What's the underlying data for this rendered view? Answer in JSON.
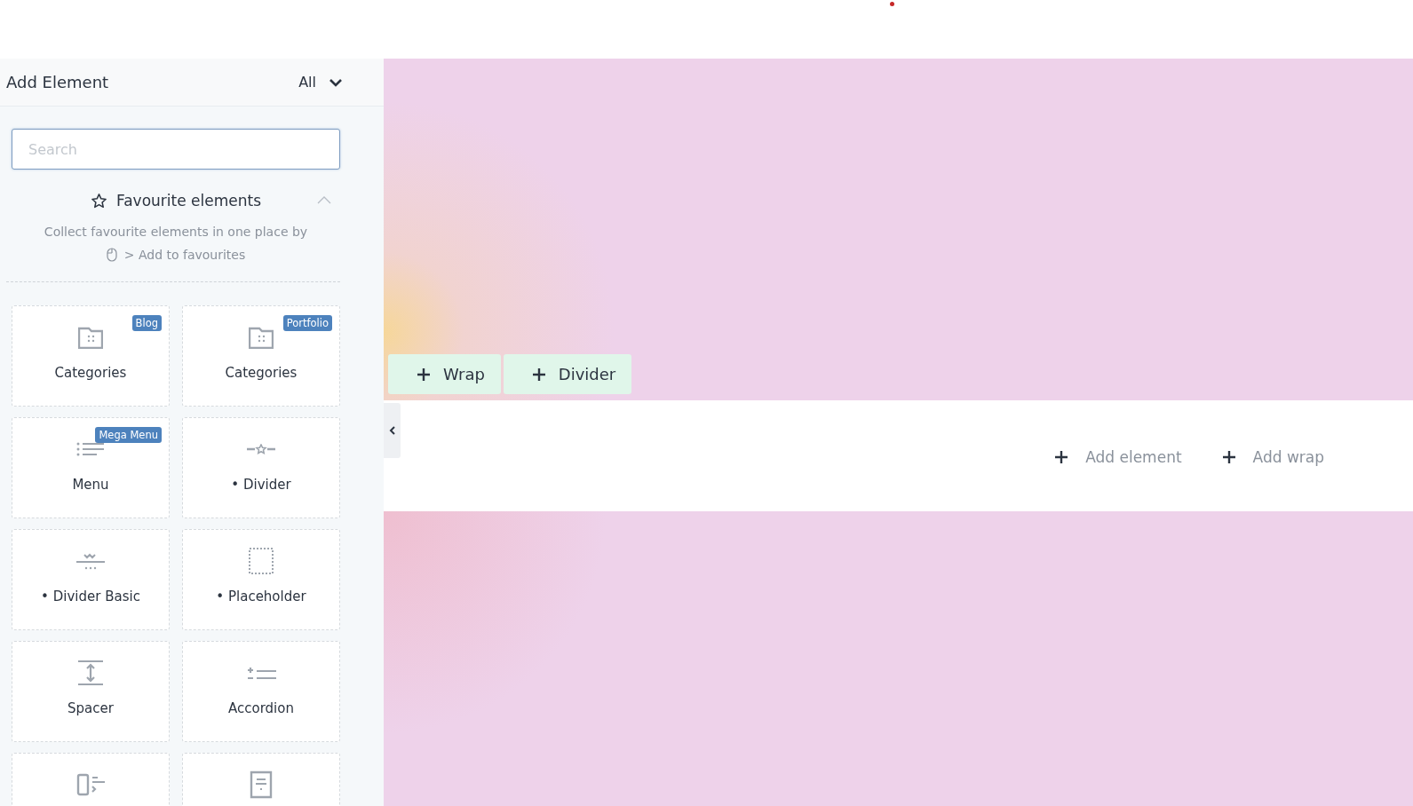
{
  "sidebar": {
    "title": "Add Element",
    "filter": "All",
    "search": {
      "placeholder": "Search"
    },
    "favourites": {
      "title": "Favourite elements",
      "expanded": true,
      "hint_line_1": "Collect favourite elements in one place by",
      "hint_line_2": "> Add to favourites"
    },
    "elements": [
      {
        "kind": "folder",
        "label": "Categories",
        "badge": "Blog"
      },
      {
        "kind": "folder",
        "label": "Categories",
        "badge": "Portfolio"
      },
      {
        "kind": "list",
        "label": "Menu",
        "badge": "Mega Menu"
      },
      {
        "kind": "stardivider",
        "label": "• Divider"
      },
      {
        "kind": "wavedivider",
        "label": "• Divider Basic"
      },
      {
        "kind": "placeholder",
        "label": "• Placeholder"
      },
      {
        "kind": "spacer",
        "label": "Spacer"
      },
      {
        "kind": "accordion",
        "label": "Accordion"
      },
      {
        "kind": "medialist"
      },
      {
        "kind": "document"
      }
    ]
  },
  "canvas": {
    "section_buttons": [
      "Wrap",
      "Divider"
    ],
    "empty_actions": [
      "Add element",
      "Add wrap"
    ]
  }
}
